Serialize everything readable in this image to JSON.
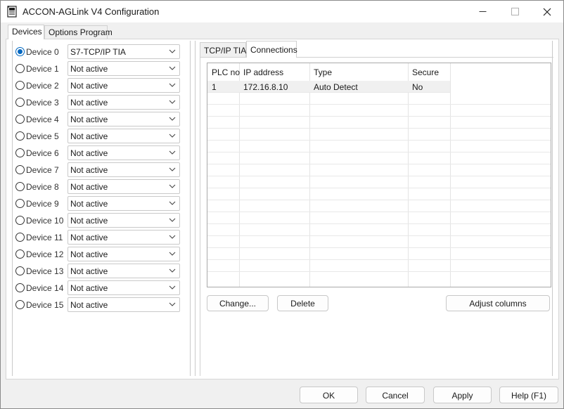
{
  "window": {
    "title": "ACCON-AGLink V4 Configuration",
    "icon": "app-icon",
    "controls": {
      "minimize": "—",
      "maximize": "☐",
      "close": "✕"
    }
  },
  "outer_tabs": [
    {
      "label": "Devices",
      "active": true
    },
    {
      "label": "Options Program",
      "active": false
    }
  ],
  "devices": [
    {
      "label": "Device 0",
      "selected": true,
      "value": "S7-TCP/IP TIA"
    },
    {
      "label": "Device 1",
      "selected": false,
      "value": "Not active"
    },
    {
      "label": "Device 2",
      "selected": false,
      "value": "Not active"
    },
    {
      "label": "Device 3",
      "selected": false,
      "value": "Not active"
    },
    {
      "label": "Device 4",
      "selected": false,
      "value": "Not active"
    },
    {
      "label": "Device 5",
      "selected": false,
      "value": "Not active"
    },
    {
      "label": "Device 6",
      "selected": false,
      "value": "Not active"
    },
    {
      "label": "Device 7",
      "selected": false,
      "value": "Not active"
    },
    {
      "label": "Device 8",
      "selected": false,
      "value": "Not active"
    },
    {
      "label": "Device 9",
      "selected": false,
      "value": "Not active"
    },
    {
      "label": "Device 10",
      "selected": false,
      "value": "Not active"
    },
    {
      "label": "Device 11",
      "selected": false,
      "value": "Not active"
    },
    {
      "label": "Device 12",
      "selected": false,
      "value": "Not active"
    },
    {
      "label": "Device 13",
      "selected": false,
      "value": "Not active"
    },
    {
      "label": "Device 14",
      "selected": false,
      "value": "Not active"
    },
    {
      "label": "Device 15",
      "selected": false,
      "value": "Not active"
    }
  ],
  "inner_tabs": [
    {
      "label": "TCP/IP TIA",
      "active": false
    },
    {
      "label": "Connections",
      "active": true
    }
  ],
  "connections": {
    "columns": [
      "PLC no",
      "IP address",
      "Type",
      "Secure"
    ],
    "rows": [
      [
        "1",
        "172.16.8.10",
        "Auto Detect",
        "No"
      ]
    ]
  },
  "connection_buttons": {
    "change": "Change...",
    "delete": "Delete",
    "adjust": "Adjust columns"
  },
  "footer": {
    "ok": "OK",
    "cancel": "Cancel",
    "apply": "Apply",
    "help": "Help (F1)"
  },
  "colors": {
    "accent": "#0067c0",
    "border": "#c9c9c9",
    "window_bg": "#f0f0f0"
  }
}
